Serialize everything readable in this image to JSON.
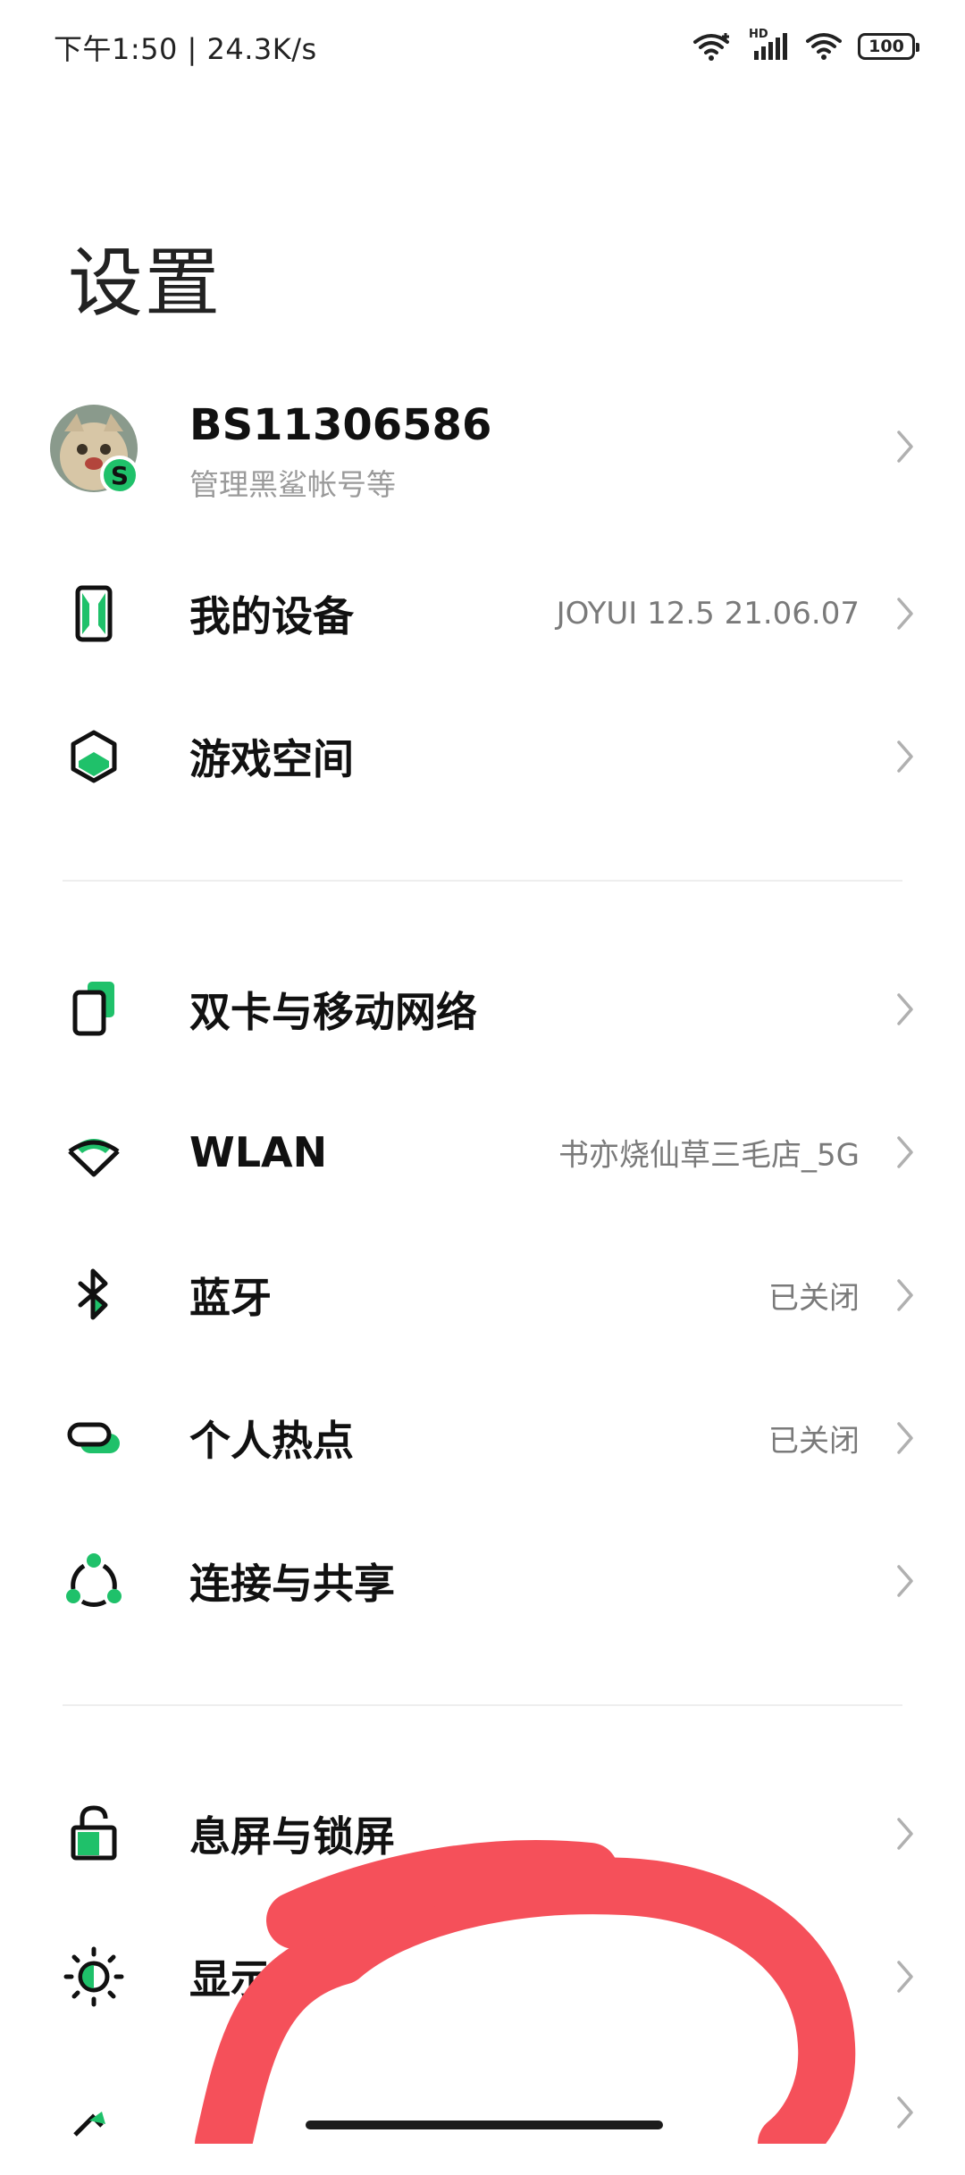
{
  "status_bar": {
    "text": "下午1:50 | 24.3K/s",
    "hd_label": "HD",
    "battery": "100"
  },
  "page_title": "设置",
  "account": {
    "name": "BS11306586",
    "subtitle": "管理黑鲨帐号等",
    "badge": "S"
  },
  "items": [
    {
      "label": "我的设备",
      "value": "JOYUI 12.5 21.06.07",
      "icon": "phone-device-icon"
    },
    {
      "label": "游戏空间",
      "value": "",
      "icon": "game-space-icon"
    },
    {
      "label": "双卡与移动网络",
      "value": "",
      "icon": "sim-card-icon"
    },
    {
      "label": "WLAN",
      "value": "书亦烧仙草三毛店_5G",
      "icon": "wifi-icon"
    },
    {
      "label": "蓝牙",
      "value": "已关闭",
      "icon": "bluetooth-icon"
    },
    {
      "label": "个人热点",
      "value": "已关闭",
      "icon": "hotspot-icon"
    },
    {
      "label": "连接与共享",
      "value": "",
      "icon": "share-icon"
    },
    {
      "label": "息屏与锁屏",
      "value": "",
      "icon": "lock-icon"
    },
    {
      "label": "显示",
      "value": "",
      "icon": "display-brightness-icon"
    }
  ],
  "colors": {
    "accent": "#1fc16a",
    "annotation": "#f5505a"
  }
}
